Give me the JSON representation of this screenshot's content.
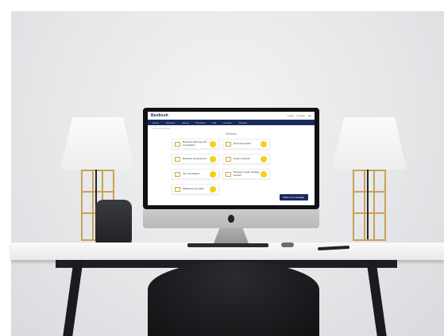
{
  "screen": {
    "logo": "Benfresh",
    "header_links": [
      "Login",
      "Contact",
      "EN"
    ],
    "nav": [
      "Home",
      "Services",
      "About",
      "Products",
      "Info",
      "Contact",
      "Support"
    ],
    "breadcrumb": "Home / Services",
    "section_title": "Services",
    "cards": [
      {
        "label": "Business planning and consultation"
      },
      {
        "label": "Personal growth"
      },
      {
        "label": "Business development"
      },
      {
        "label": "Project portfolio"
      },
      {
        "label": "Tax consultation"
      },
      {
        "label": "Business owner strategy support"
      },
      {
        "label": "Marketing and sales"
      }
    ],
    "assist_button": "Write us a message"
  },
  "colors": {
    "nav_bg": "#1a2a5c",
    "accent_yellow": "#f1d11c",
    "lamp_brass": "#c9a15a"
  },
  "icons": [
    "document-icon",
    "yellow-circle-icon",
    "apple-logo-icon"
  ]
}
